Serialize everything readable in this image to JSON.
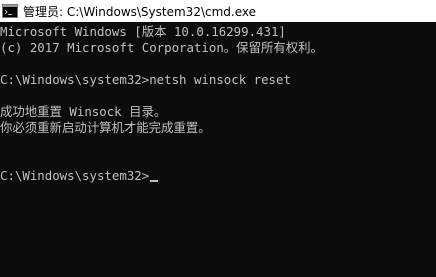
{
  "window": {
    "title": "管理员: C:\\Windows\\System32\\cmd.exe",
    "icon": "cmd-icon"
  },
  "console": {
    "lines": [
      "Microsoft Windows [版本 10.0.16299.431]",
      "(c) 2017 Microsoft Corporation。保留所有权利。",
      "C:\\Windows\\system32>netsh winsock reset",
      "成功地重置 Winsock 目录。",
      "你必须重新启动计算机才能完成重置。",
      "C:\\Windows\\system32>"
    ]
  },
  "colors": {
    "background": "#0c0c0c",
    "text": "#c0c0c0",
    "titlebar": "#ffffff"
  }
}
